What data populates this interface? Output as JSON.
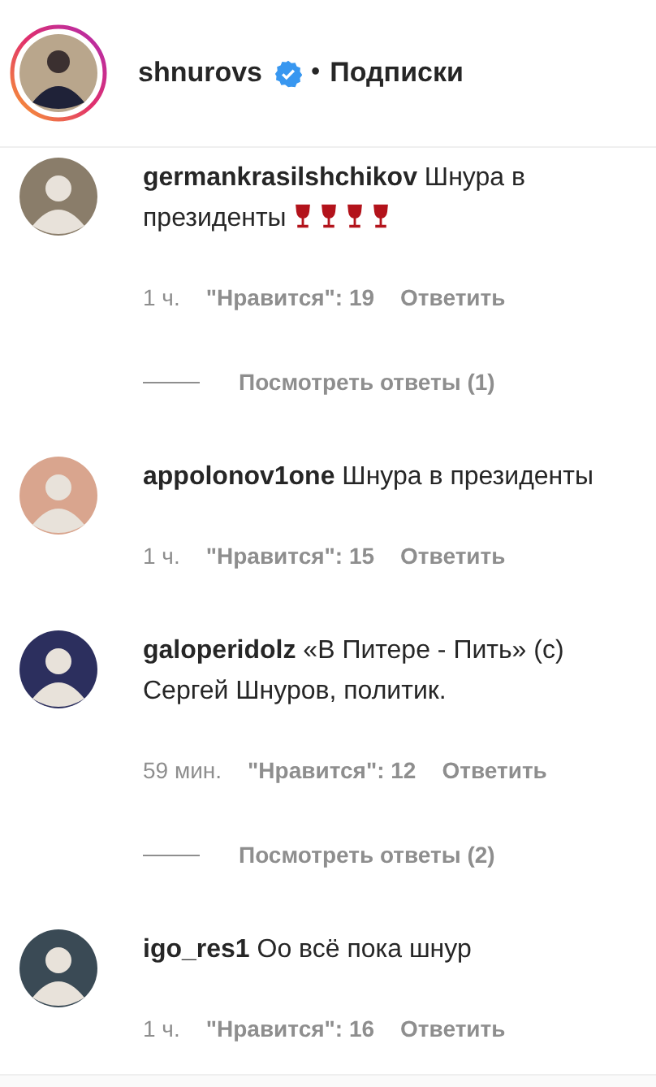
{
  "header": {
    "username": "shnurovs",
    "verified": true,
    "separator": "•",
    "follow": "Подписки"
  },
  "comments": [
    {
      "user": "germankrasilshchikov",
      "text": "Шнура в президенты",
      "icons": [
        {
          "kind": "wine_glass"
        },
        {
          "kind": "wine_glass"
        },
        {
          "kind": "wine_glass"
        },
        {
          "kind": "wine_glass"
        }
      ],
      "time": "1 ч.",
      "likes": "\"Нравится\": 19",
      "reply": "Ответить",
      "replies": "Посмотреть ответы (1)"
    },
    {
      "user": "appolonov1one",
      "text": "Шнура в президенты",
      "time": "1 ч.",
      "likes": "\"Нравится\": 15",
      "reply": "Ответить"
    },
    {
      "user": "galoperidolz",
      "text": "«В Питере - Пить» (c) Сергей Шнуров, политик.",
      "time": "59 мин.",
      "likes": "\"Нравится\": 12",
      "reply": "Ответить",
      "replies": "Посмотреть ответы (2)"
    },
    {
      "user": "igo_res1",
      "text": "Оо всё пока шнур",
      "time": "1 ч.",
      "likes": "\"Нравится\": 16",
      "reply": "Ответить"
    }
  ]
}
